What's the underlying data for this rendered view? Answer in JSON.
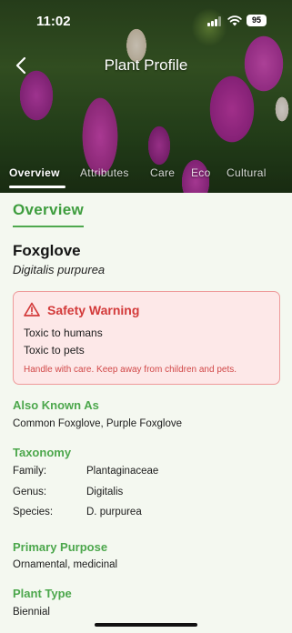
{
  "status": {
    "time": "11:02",
    "battery": "95"
  },
  "nav": {
    "title": "Plant Profile"
  },
  "tabs": [
    {
      "label": "Overview",
      "active": true
    },
    {
      "label": "Attributes",
      "active": false
    },
    {
      "label": "Care",
      "active": false
    },
    {
      "label": "Eco",
      "active": false
    },
    {
      "label": "Cultural",
      "active": false
    }
  ],
  "section": {
    "title": "Overview"
  },
  "plant": {
    "common_name": "Foxglove",
    "scientific_name": "Digitalis purpurea"
  },
  "warning": {
    "title": "Safety Warning",
    "lines": [
      "Toxic to humans",
      "Toxic to pets"
    ],
    "note": "Handle with care. Keep away from children and pets."
  },
  "also_known_as": {
    "heading": "Also Known As",
    "value": "Common Foxglove, Purple Foxglove"
  },
  "taxonomy": {
    "heading": "Taxonomy",
    "rows": [
      {
        "key": "Family:",
        "value": "Plantaginaceae"
      },
      {
        "key": "Genus:",
        "value": "Digitalis"
      },
      {
        "key": "Species:",
        "value": "D. purpurea"
      }
    ]
  },
  "primary_purpose": {
    "heading": "Primary Purpose",
    "value": "Ornamental, medicinal"
  },
  "plant_type": {
    "heading": "Plant Type",
    "value": "Biennial"
  },
  "colors": {
    "accent": "#4ca74c",
    "warning": "#d33a3a",
    "warning_bg": "#fde8e8"
  }
}
